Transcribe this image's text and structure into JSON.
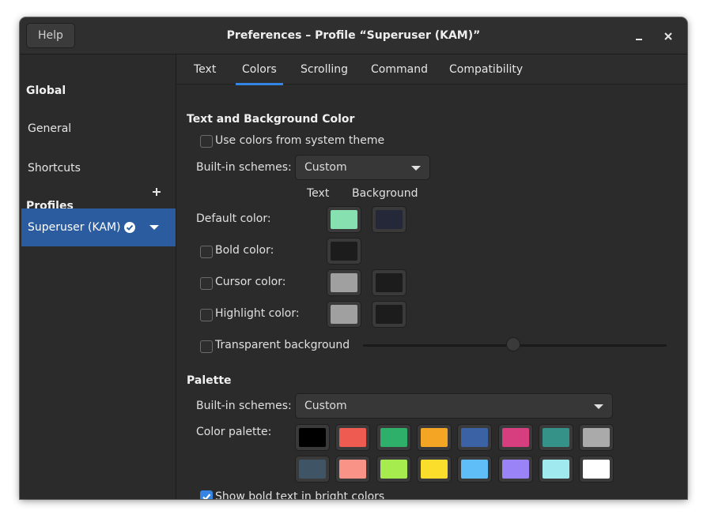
{
  "titlebar": {
    "help_label": "Help",
    "title": "Preferences – Profile “Superuser (KAM)”"
  },
  "sidebar": {
    "global_header": "Global",
    "items": [
      {
        "label": "General"
      },
      {
        "label": "Shortcuts"
      }
    ],
    "profiles_header": "Profiles",
    "profile": {
      "name": "Superuser (KAM)",
      "default": true
    }
  },
  "tabs": [
    {
      "label": "Text",
      "active": false
    },
    {
      "label": "Colors",
      "active": true
    },
    {
      "label": "Scrolling",
      "active": false
    },
    {
      "label": "Command",
      "active": false
    },
    {
      "label": "Compatibility",
      "active": false
    }
  ],
  "text_bg": {
    "section_title": "Text and Background Color",
    "use_system_label": "Use colors from system theme",
    "use_system_checked": false,
    "schemes_label": "Built-in schemes:",
    "schemes_value": "Custom",
    "col_text": "Text",
    "col_background": "Background",
    "default_label": "Default color:",
    "default_text_color": "#86e0b0",
    "default_bg_color": "#242838",
    "bold_label": "Bold color:",
    "bold_color": "#1c1c1c",
    "cursor_label": "Cursor color:",
    "cursor_text_color": "#a0a0a0",
    "cursor_bg_color": "#1c1c1c",
    "highlight_label": "Highlight color:",
    "highlight_text_color": "#a0a0a0",
    "highlight_bg_color": "#1c1c1c",
    "transparent_label": "Transparent background",
    "transparency_level": 0.5
  },
  "palette": {
    "section_title": "Palette",
    "schemes_label": "Built-in schemes:",
    "schemes_value": "Custom",
    "palette_label": "Color palette:",
    "colors_row1": [
      "#000000",
      "#ee5b50",
      "#2fb06a",
      "#f5a524",
      "#3a62a4",
      "#d63e7f",
      "#349289",
      "#aaaaaa"
    ],
    "colors_row2": [
      "#3f5565",
      "#f99388",
      "#a6ec4e",
      "#fbde2c",
      "#5fbdf8",
      "#9a82f7",
      "#a0e9ee",
      "#ffffff"
    ],
    "bold_bright_label": "Show bold text in bright colors",
    "bold_bright_checked": true
  },
  "icons": {
    "minimize": "minimize-icon",
    "close": "close-icon",
    "add": "plus-icon",
    "default_profile": "check-circle-icon",
    "profile_menu": "chevron-down-icon"
  },
  "colors": {
    "accent": "#3584e4",
    "selected_row": "#2a5c9f",
    "window_bg": "#2b2b2b"
  }
}
